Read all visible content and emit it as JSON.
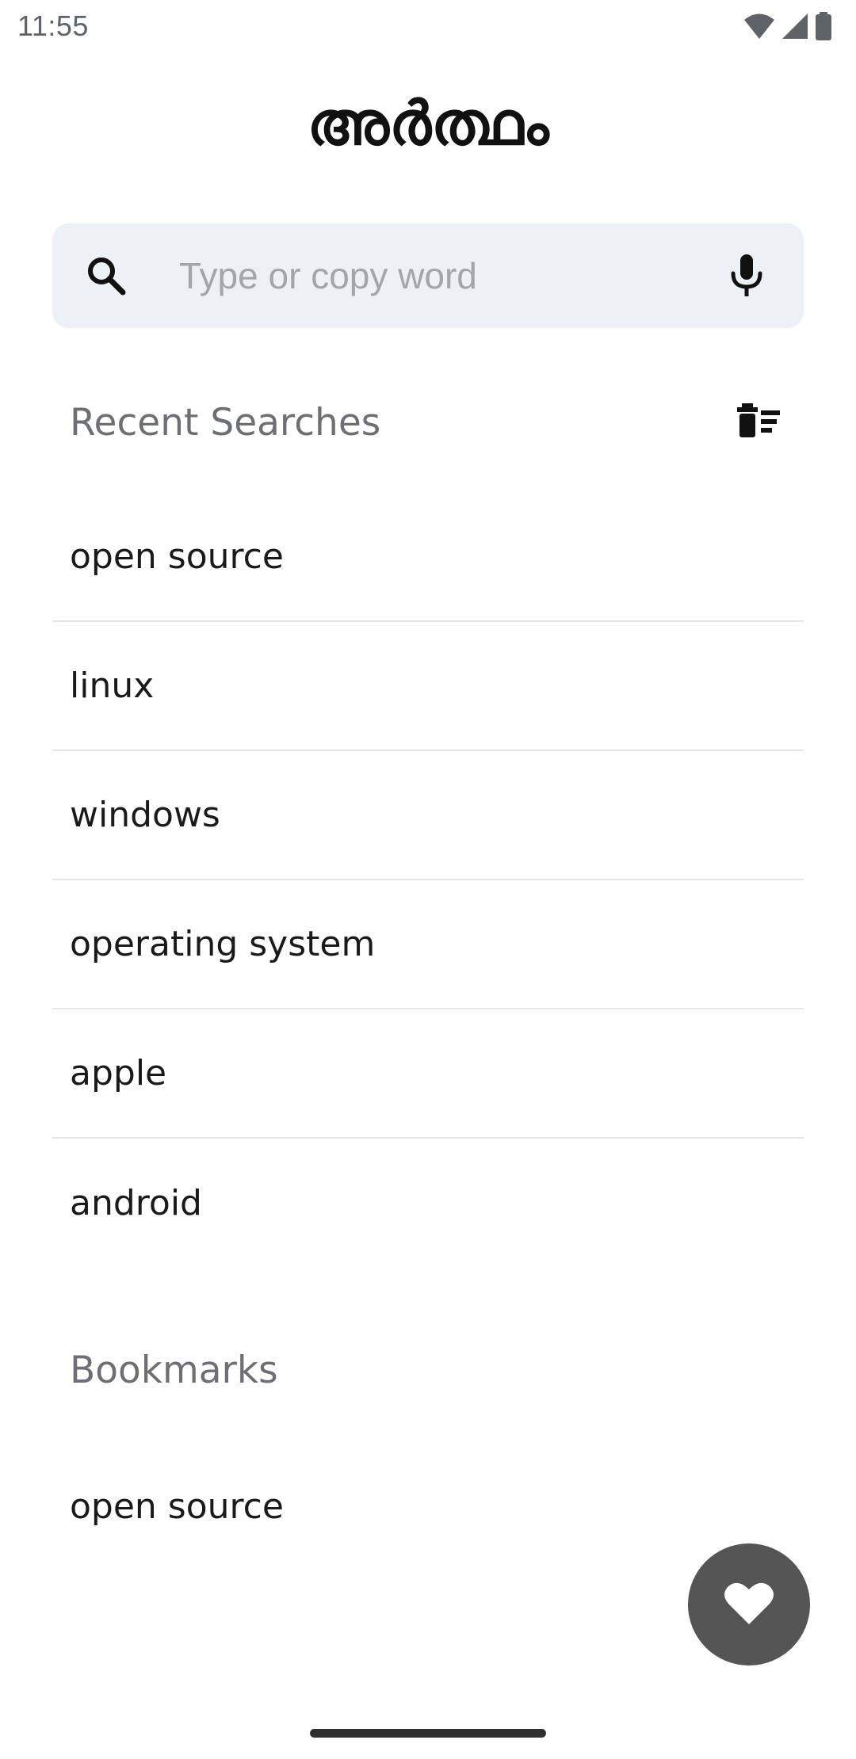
{
  "status_bar": {
    "time": "11:55",
    "icons": [
      "wifi-icon",
      "cell-signal-icon",
      "battery-icon"
    ]
  },
  "header": {
    "title": "അർത്ഥം"
  },
  "search": {
    "placeholder": "Type or copy word",
    "value": "",
    "left_icon": "search-icon",
    "right_icon": "mic-icon"
  },
  "recent": {
    "heading": "Recent Searches",
    "clear_icon": "clear-history-icon",
    "items": [
      {
        "label": "open source"
      },
      {
        "label": "linux"
      },
      {
        "label": "windows"
      },
      {
        "label": "operating system"
      },
      {
        "label": "apple"
      },
      {
        "label": "android"
      }
    ]
  },
  "bookmarks": {
    "heading": "Bookmarks",
    "items": [
      {
        "label": "open source"
      }
    ]
  },
  "fab": {
    "icon": "heart-icon",
    "color": "#555555"
  },
  "colors": {
    "search_background": "#edf0f5",
    "section_heading": "#6e6f73",
    "divider": "#e6e6e6"
  }
}
